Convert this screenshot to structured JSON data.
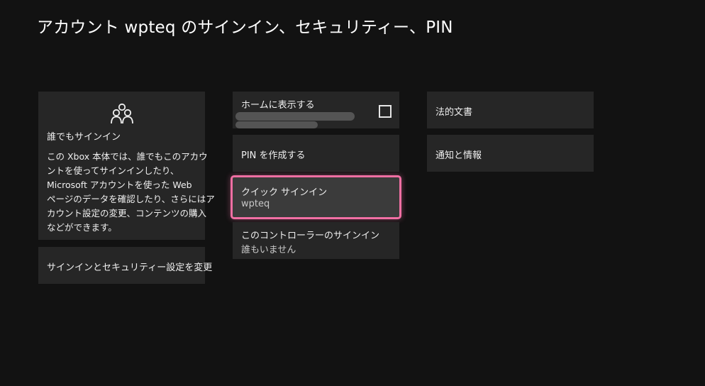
{
  "header": {
    "title": "アカウント  wpteq のサインイン、セキュリティー、PIN"
  },
  "left_column": {
    "everyone": {
      "icon": "people-icon",
      "title": "誰でもサインイン",
      "description_lines": [
        "この Xbox 本体では、誰でもこのアカウ",
        "ントを使ってサインインしたり、",
        "Microsoft アカウントを使った Web",
        "ページのデータを確認したり、さらにはア",
        "カウント設定の変更、コンテンツの購入",
        "などができます。"
      ]
    },
    "change_settings_label": "サインインとセキュリティー設定を変更"
  },
  "middle_column": {
    "show_on_home": {
      "label": "ホームに表示する",
      "checked": false
    },
    "create_pin_label": "PIN を作成する",
    "quick_signin": {
      "label": "クイック サインイン",
      "value": "wpteq"
    },
    "controller_signin": {
      "label": "このコントローラーのサインイン",
      "value": "誰もいません"
    }
  },
  "right_column": {
    "legal_label": "法的文書",
    "notices_label": "通知と情報"
  },
  "colors": {
    "background": "#121212",
    "tile": "#262626",
    "focused_tile": "#3b3b3b",
    "focus_outline": "#f06fa3"
  }
}
